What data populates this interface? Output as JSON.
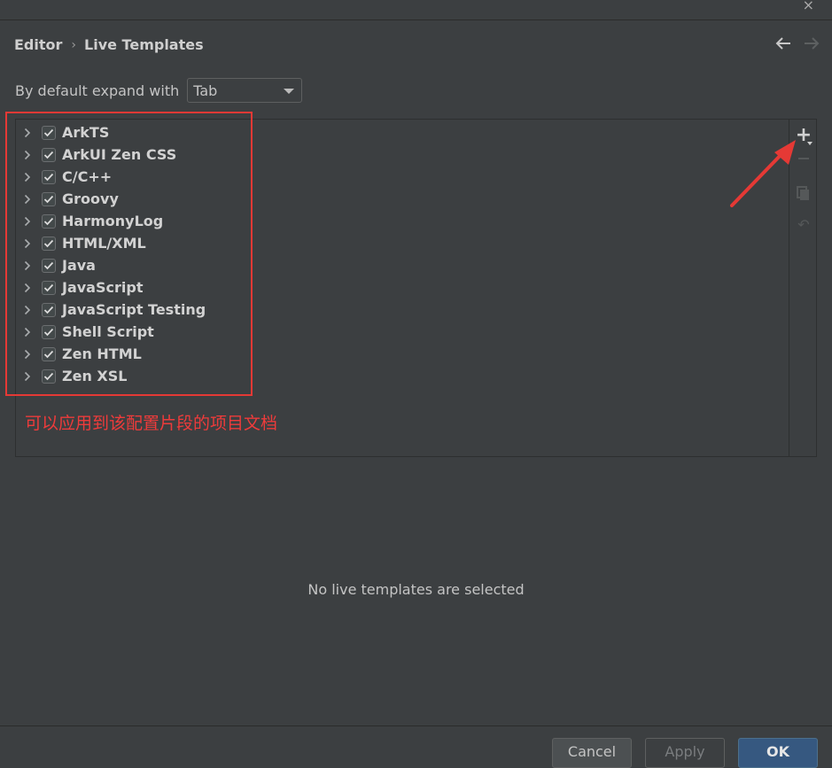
{
  "window": {
    "close_label": "×"
  },
  "breadcrumb": {
    "parent": "Editor",
    "separator": "›",
    "current": "Live Templates"
  },
  "nav": {
    "back_icon": "arrow-left-icon",
    "forward_icon": "arrow-right-icon"
  },
  "expand": {
    "label": "By default expand with",
    "value": "Tab"
  },
  "template_groups": [
    {
      "label": "ArkTS",
      "checked": true
    },
    {
      "label": "ArkUI Zen CSS",
      "checked": true
    },
    {
      "label": "C/C++",
      "checked": true
    },
    {
      "label": "Groovy",
      "checked": true
    },
    {
      "label": "HarmonyLog",
      "checked": true
    },
    {
      "label": "HTML/XML",
      "checked": true
    },
    {
      "label": "Java",
      "checked": true
    },
    {
      "label": "JavaScript",
      "checked": true
    },
    {
      "label": "JavaScript Testing",
      "checked": true
    },
    {
      "label": "Shell Script",
      "checked": true
    },
    {
      "label": "Zen HTML",
      "checked": true
    },
    {
      "label": "Zen XSL",
      "checked": true
    }
  ],
  "toolbar": {
    "add_symbol": "+",
    "revert_symbol": "↶"
  },
  "annotation": {
    "text": "可以应用到该配置片段的项目文档",
    "color": "#ee3b3b"
  },
  "empty_message": "No live templates are selected",
  "buttons": {
    "cancel": "Cancel",
    "apply": "Apply",
    "ok": "OK"
  },
  "colors": {
    "background": "#3c3f41",
    "accent": "#365880",
    "highlight": "#e53935"
  }
}
